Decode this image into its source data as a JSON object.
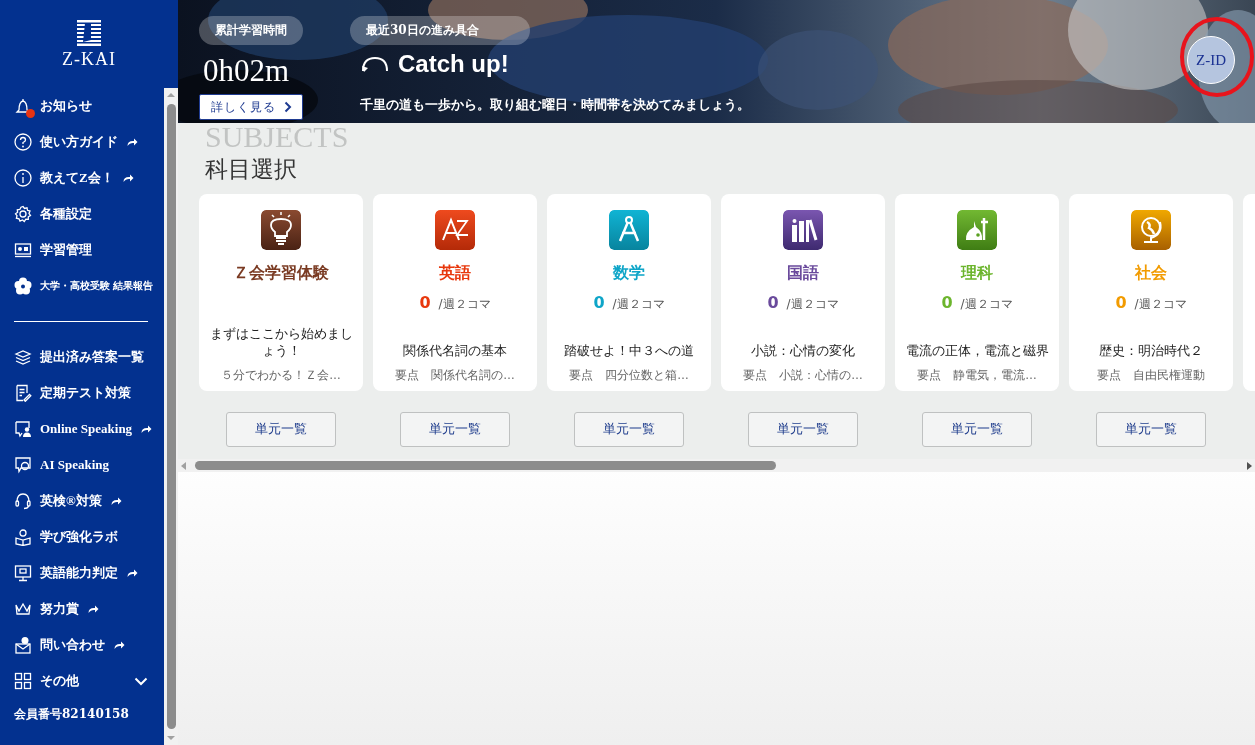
{
  "sidebar": {
    "logo": "Z-KAI",
    "items": [
      {
        "label": "お知らせ",
        "external": false,
        "badge": true
      },
      {
        "label": "使い方ガイド",
        "external": true,
        "badge": false
      },
      {
        "label": "教えてZ会！",
        "external": true,
        "badge": false
      },
      {
        "label": "各種設定",
        "external": false,
        "badge": false
      },
      {
        "label": "学習管理",
        "external": false,
        "badge": false
      },
      {
        "label": "大学・高校受験 結果報告",
        "external": false,
        "badge": false
      }
    ],
    "items_2": [
      {
        "label": "提出済み答案一覧",
        "kind": "link",
        "external": false
      },
      {
        "label": "定期テスト対策",
        "kind": "link",
        "external": false
      },
      {
        "label": "Online Speaking",
        "kind": "link",
        "external": true
      },
      {
        "label": "AI Speaking",
        "kind": "link",
        "external": false
      },
      {
        "label": "英検®対策",
        "kind": "link",
        "external": true
      },
      {
        "label": "学び強化ラボ",
        "kind": "link",
        "external": false
      },
      {
        "label": "英語能力判定",
        "kind": "link",
        "external": true
      },
      {
        "label": "努力賞",
        "kind": "link",
        "external": true
      },
      {
        "label": "問い合わせ",
        "kind": "link",
        "external": true
      },
      {
        "label": "その他",
        "kind": "group",
        "external": false,
        "expanded": false
      }
    ],
    "member_number": "会員番号82140158"
  },
  "hero": {
    "total_time": {
      "label": "累計学習時間",
      "value": "0h02m",
      "button": "詳しく見る"
    },
    "progress": {
      "label": "最近30日の進み具合",
      "status": "Catch up!",
      "message": "千里の道も一歩から。取り組む曜日・時間帯を決めてみましょう。"
    },
    "account_button": "Z-ID"
  },
  "subjects": {
    "heading": "科目選択",
    "heading_backdrop": "SUBJECTS",
    "cards": [
      {
        "kind": "trial",
        "name": "Ｚ会学習体験",
        "color": "#7a3a22",
        "lesson": "まずはここから始めましょう！",
        "summary": "５分でわかる！Ｚ会…",
        "button": "単元一覧"
      },
      {
        "kind": "subject",
        "name": "英語",
        "color": "#e8380d",
        "count": "0",
        "quota": "/週２コマ",
        "lesson": "関係代名詞の基本",
        "summary": "要点　関係代名詞の…",
        "button": "単元一覧"
      },
      {
        "kind": "subject",
        "name": "数学",
        "color": "#0ea5c8",
        "count": "0",
        "quota": "/週２コマ",
        "lesson": "踏破せよ！中３への道",
        "summary": "要点　四分位数と箱…",
        "button": "単元一覧"
      },
      {
        "kind": "subject",
        "name": "国語",
        "color": "#6a4a9c",
        "count": "0",
        "quota": "/週２コマ",
        "lesson": "小説：心情の変化",
        "summary": "要点　小説：心情の…",
        "button": "単元一覧"
      },
      {
        "kind": "subject",
        "name": "理科",
        "color": "#6cb52d",
        "count": "0",
        "quota": "/週２コマ",
        "lesson": "電流の正体，電流と磁界",
        "summary": "要点　静電気，電流…",
        "button": "単元一覧"
      },
      {
        "kind": "subject",
        "name": "社会",
        "color": "#f29b00",
        "count": "0",
        "quota": "/週２コマ",
        "lesson": "歴史：明治時代２",
        "summary": "要点　自由民権運動",
        "button": "単元一覧"
      }
    ]
  }
}
